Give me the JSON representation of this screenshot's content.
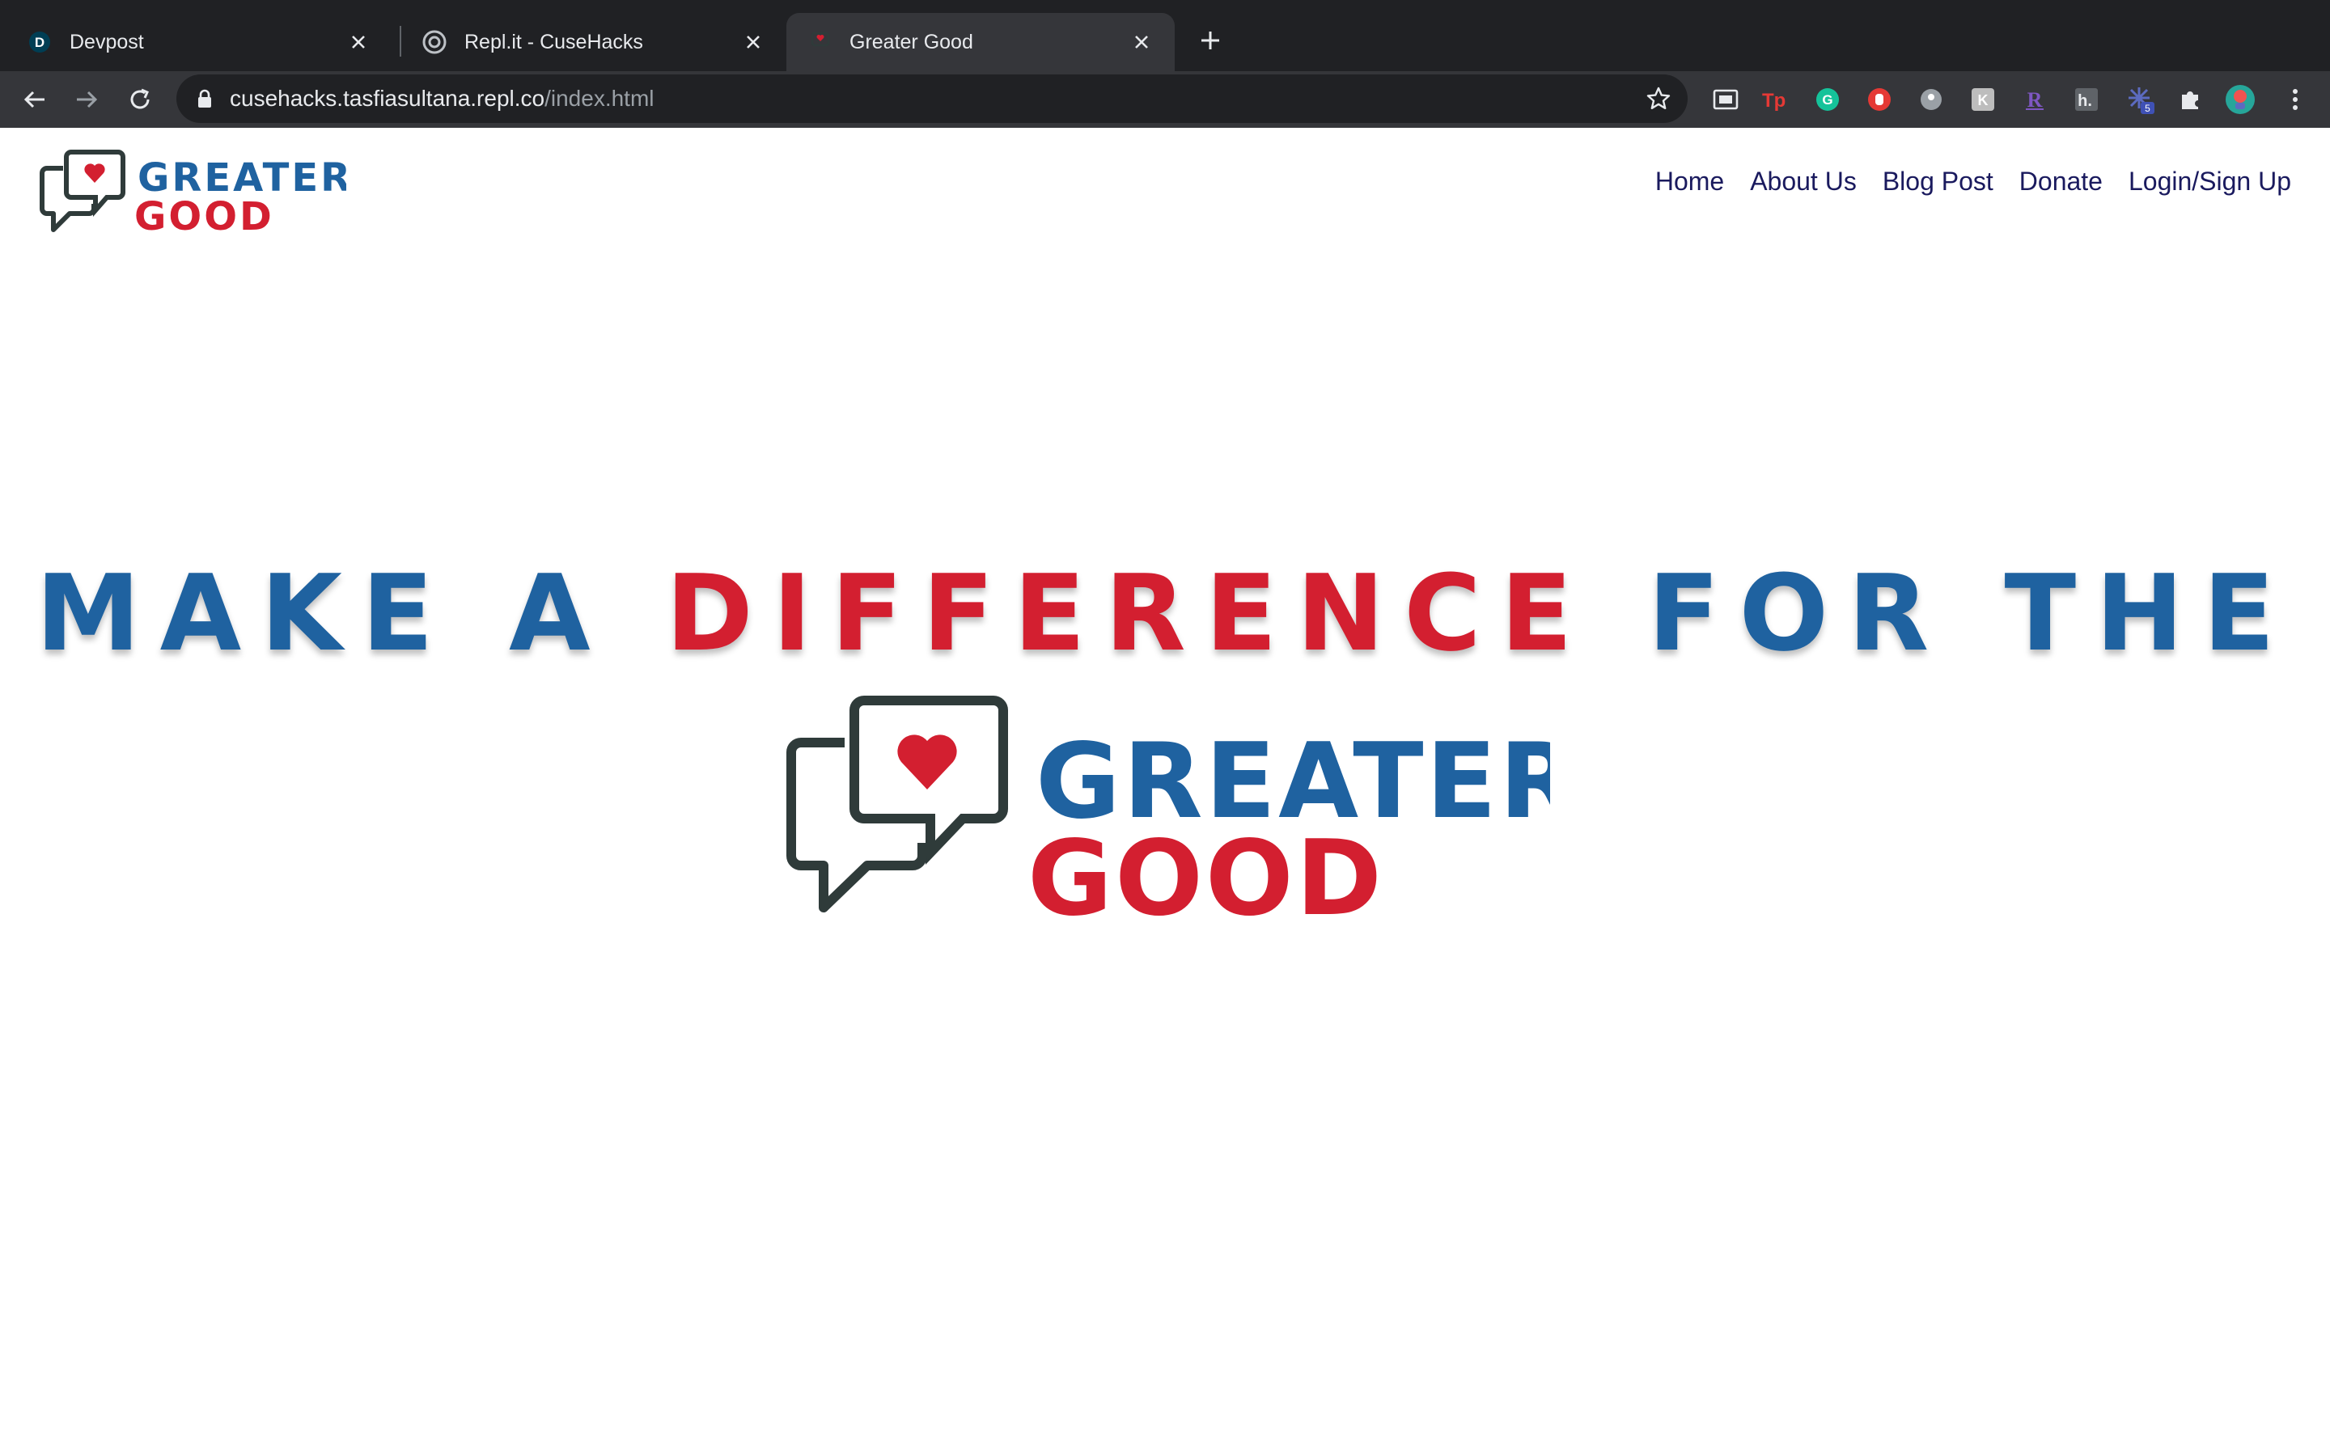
{
  "browser": {
    "tabs": [
      {
        "title": "Devpost",
        "favicon_letter": "D",
        "active": false
      },
      {
        "title": "Repl.it - CuseHacks",
        "active": false
      },
      {
        "title": "Greater Good",
        "active": true
      }
    ],
    "url_host": "cusehacks.tasfiasultana.repl.co",
    "url_path": "/index.html",
    "extension_badge": "5",
    "icons": [
      "back-icon",
      "forward-icon",
      "reload-icon",
      "lock-icon",
      "star-icon",
      "cast-icon",
      "tp-extension-icon",
      "grammarly-icon",
      "hand-icon",
      "circle-extension-icon",
      "k-extension-icon",
      "r-extension-icon",
      "h-extension-icon",
      "burst-extension-icon",
      "puzzle-icon",
      "profile-avatar",
      "menu-icon"
    ]
  },
  "site": {
    "logo": {
      "line1": "GREATER",
      "line2": "GOOD"
    },
    "nav": [
      "Home",
      "About Us",
      "Blog Post",
      "Donate",
      "Login/Sign Up"
    ]
  },
  "hero": {
    "part1": "MAKE A",
    "part2": "DIFFERENCE",
    "part3": "FOR THE",
    "logo": {
      "line1": "GREATER",
      "line2": "GOOD"
    }
  },
  "colors": {
    "brand_blue": "#1f62a0",
    "brand_red": "#d31f30",
    "icon_dark": "#2f3b3a",
    "nav_text": "#1a1a5e"
  }
}
